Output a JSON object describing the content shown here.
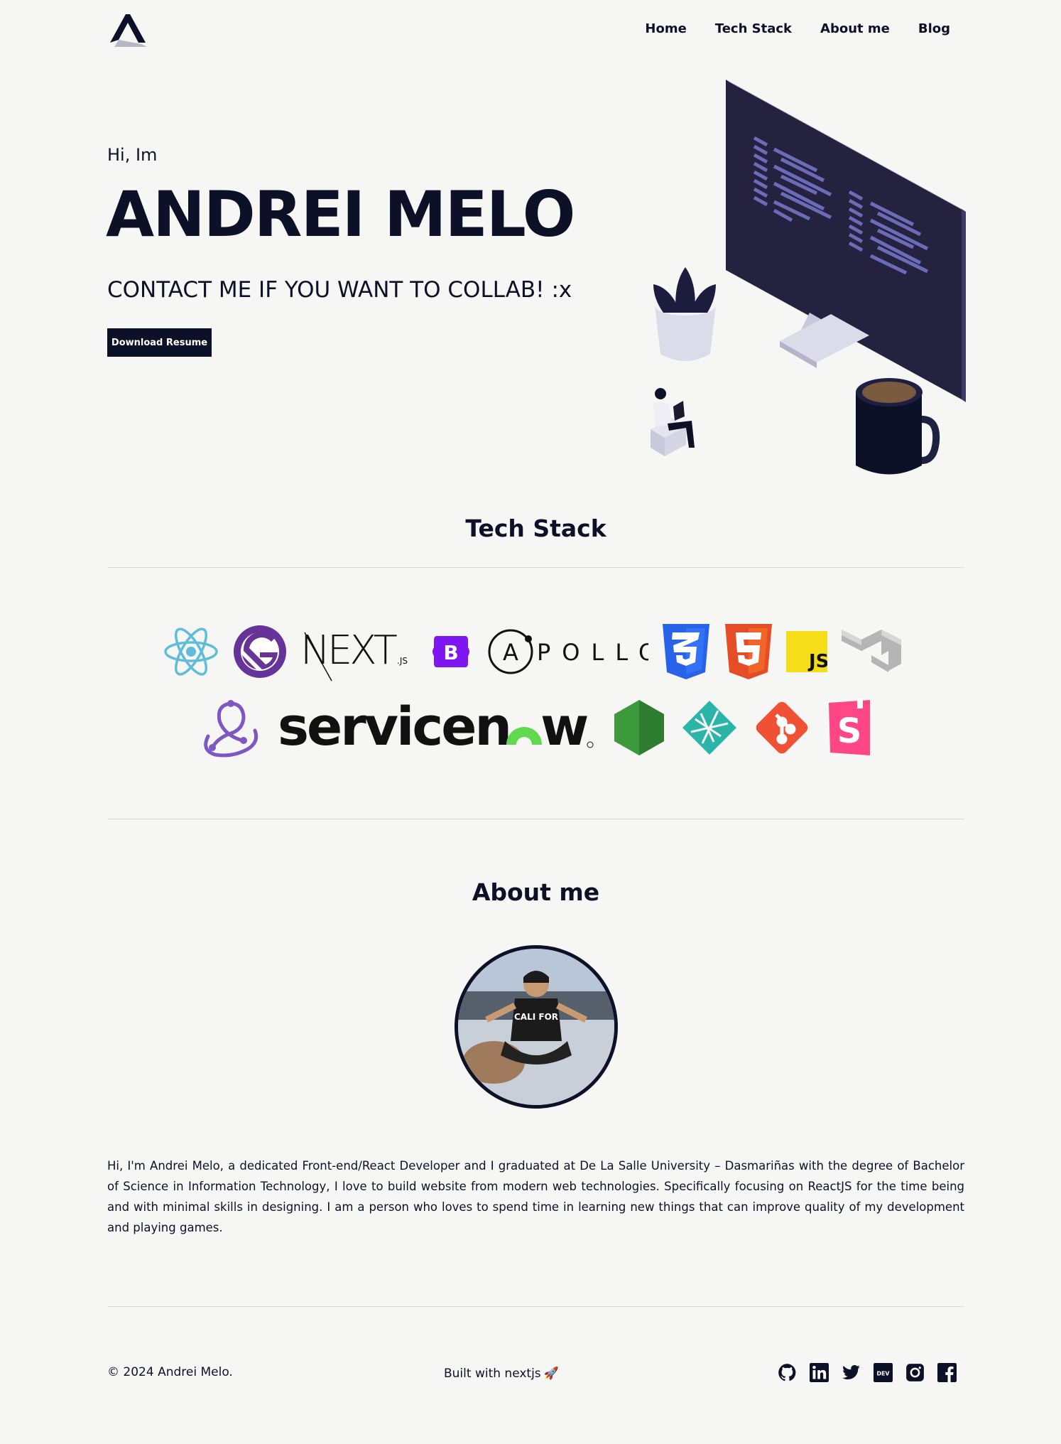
{
  "nav": {
    "items": [
      {
        "label": "Home"
      },
      {
        "label": "Tech Stack"
      },
      {
        "label": "About me"
      },
      {
        "label": "Blog"
      }
    ]
  },
  "hero": {
    "greeting": "Hi, Im",
    "name": "ANDREI MELO",
    "tagline": "CONTACT ME IF YOU WANT TO COLLAB! :x",
    "resume_button": "Download Resume"
  },
  "tech_stack": {
    "title": "Tech Stack",
    "logos": [
      "react-icon",
      "gatsby-icon",
      "nextjs-logo",
      "bootstrap-icon",
      "apollo-logo",
      "css3-icon",
      "html5-icon",
      "javascript-icon",
      "mui-icon",
      "redux-icon",
      "servicenow-logo",
      "nodejs-icon",
      "netlify-icon",
      "git-icon",
      "storybook-icon"
    ],
    "logo_text": {
      "next": "NEXT",
      "next_js": ".JS",
      "apollo": "APOLLO",
      "apollo_a": "A",
      "servicenow": "servicen",
      "servicenow_w": "w",
      "bootstrap": "B",
      "js": "JS",
      "storybook": "S"
    }
  },
  "about": {
    "title": "About me",
    "avatar_shirt": "CALI FOR",
    "bio": "Hi, I'm Andrei Melo, a dedicated Front-end/React Developer and I graduated at De La Salle University – Dasmariñas with the degree of Bachelor of Science in Information Technology, I love to build website from modern web technologies. Specifically focusing on ReactJS for the time being and with minimal skills in designing. I am a person who loves to spend time in learning new things that can improve quality of my development and playing games."
  },
  "footer": {
    "copyright": "© 2024 Andrei Melo.",
    "built_with": "Built with nextjs",
    "rocket": "🚀",
    "socials": [
      "github-icon",
      "linkedin-icon",
      "twitter-icon",
      "dev-icon",
      "instagram-icon",
      "facebook-icon"
    ],
    "dev_label": "DEV"
  },
  "colors": {
    "background": "#f6f7f5",
    "primary": "#0d1128"
  }
}
